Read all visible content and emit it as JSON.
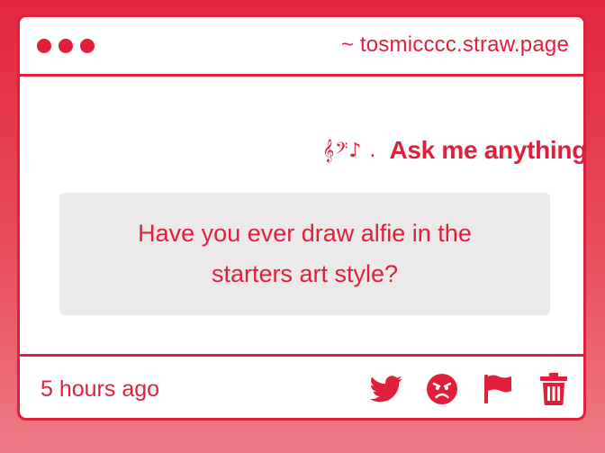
{
  "window": {
    "url": "~ tosmicccc.straw.page"
  },
  "header": {
    "decor": "𝄞𝄢♪ .",
    "title": "Ask me anything"
  },
  "question": {
    "text": "Have you ever draw alfie in the starters art style?"
  },
  "footer": {
    "time": "5 hours ago",
    "actions": [
      "twitter-icon",
      "angry-face-icon",
      "flag-icon",
      "trash-icon"
    ]
  },
  "colors": {
    "accent": "#e0203a",
    "question_bg": "#ebe9ea",
    "card_bg": "#ffffff"
  }
}
